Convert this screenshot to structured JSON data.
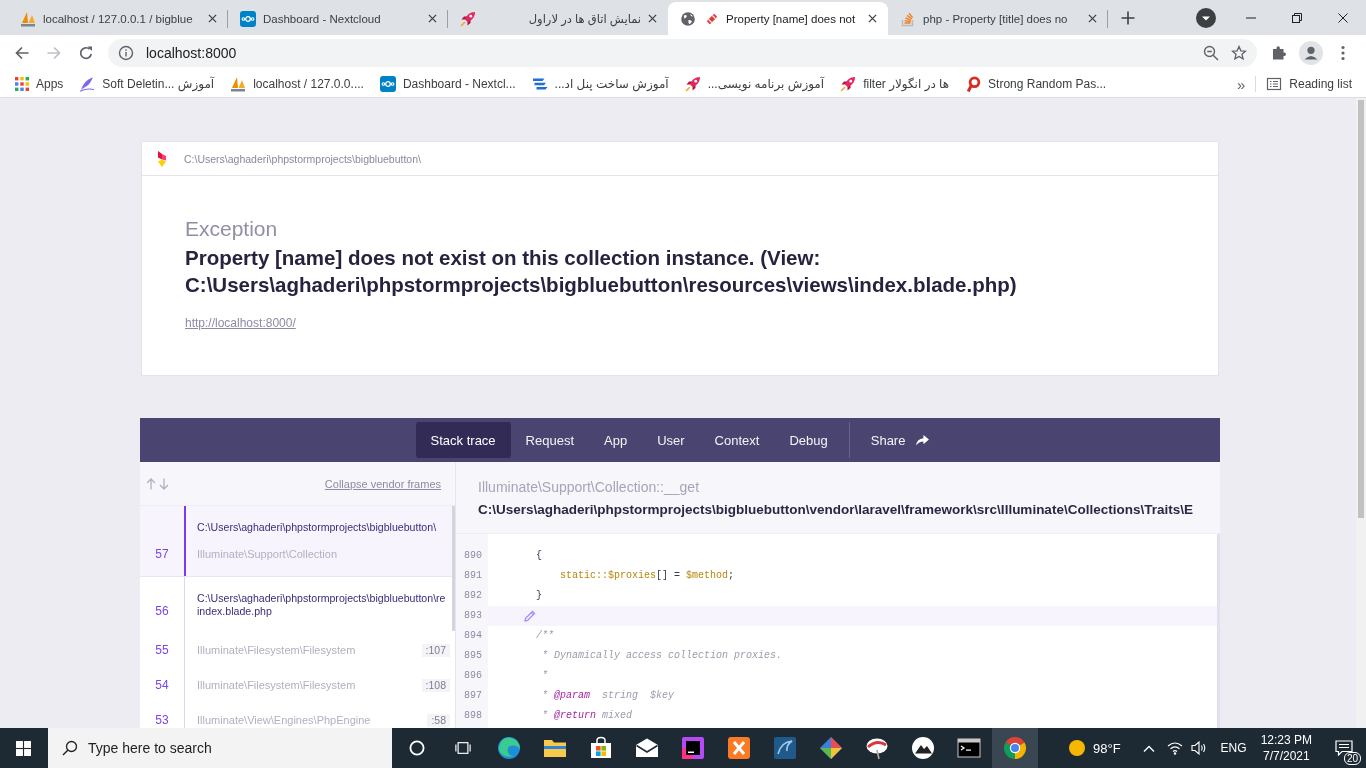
{
  "browser": {
    "tabs": [
      {
        "title": "localhost / 127.0.0.1 / bigblue",
        "selected": false
      },
      {
        "title": "Dashboard - Nextcloud",
        "selected": false
      },
      {
        "title": "نمایش اتاق ها در لاراول",
        "selected": false
      },
      {
        "title": "Property [name] does not",
        "selected": true
      },
      {
        "title": "php - Property [title] does no",
        "selected": false
      }
    ],
    "back_disabled": false,
    "forward_disabled": true,
    "address": "localhost:8000",
    "bookmarks": [
      "Apps",
      "Soft Deletin... آموزش",
      "localhost / 127.0.0....",
      "Dashboard - Nextcl...",
      "آموزش ساخت پنل اد...",
      "آموزش برنامه نویسی...",
      "filter ها در انگولار",
      "Strong Random Pas..."
    ],
    "bookmarks_overflow": "»",
    "reading_list": "Reading list"
  },
  "header": {
    "path": "C:\\Users\\aghaderi\\phpstormprojects\\bigbluebutton\\",
    "exception": "Exception",
    "message": "Property [name] does not exist on this collection instance. (View: C:\\Users\\aghaderi\\phpstormprojects\\bigbluebutton\\resources\\views\\index.blade.php)",
    "url": "http://localhost:8000/"
  },
  "nav": {
    "tabs": [
      {
        "label": "Stack trace",
        "selected": true
      },
      {
        "label": "Request",
        "selected": false
      },
      {
        "label": "App",
        "selected": false
      },
      {
        "label": "User",
        "selected": false
      },
      {
        "label": "Context",
        "selected": false
      },
      {
        "label": "Debug",
        "selected": false
      }
    ],
    "share": "Share"
  },
  "frames": {
    "collapse": "Collapse vendor frames",
    "items": [
      {
        "number": "57",
        "file": "C:\\Users\\aghaderi\\phpstormprojects\\bigbluebutton\\",
        "class": "Illuminate\\Support\\Collection",
        "selected": true
      },
      {
        "number": "56",
        "file": "C:\\Users\\aghaderi\\phpstormprojects\\bigbluebutton\\re",
        "file_name": "index.blade.php",
        "selected": false
      },
      {
        "number": "55",
        "class": "Illuminate\\Filesystem\\Filesystem",
        "line": ":107",
        "selected": false
      },
      {
        "number": "54",
        "class": "Illuminate\\Filesystem\\Filesystem",
        "line": ":108",
        "selected": false
      },
      {
        "number": "53",
        "class": "Illuminate\\View\\Engines\\PhpEngine",
        "line": ":58",
        "selected": false
      }
    ]
  },
  "code": {
    "signature": "Illuminate\\Support\\Collection::__get",
    "file": "C:\\Users\\aghaderi\\phpstormprojects\\bigbluebutton\\vendor\\laravel\\framework\\src\\Illuminate\\Collections\\Traits\\E",
    "lines": [
      {
        "number": "890",
        "highlighted": false,
        "tokens": [
          {
            "text": "    {",
            "kind": "plain"
          }
        ]
      },
      {
        "number": "891",
        "highlighted": false,
        "tokens": [
          {
            "text": "        static::$proxies",
            "kind": "variable"
          },
          {
            "text": "[] = ",
            "kind": "plain"
          },
          {
            "text": "$method",
            "kind": "variable"
          },
          {
            "text": ";",
            "kind": "plain"
          }
        ]
      },
      {
        "number": "892",
        "highlighted": false,
        "tokens": [
          {
            "text": "    }",
            "kind": "plain"
          }
        ]
      },
      {
        "number": "893",
        "highlighted": true
      },
      {
        "number": "894",
        "highlighted": false,
        "tokens": [
          {
            "text": "    /**",
            "kind": "comment"
          }
        ]
      },
      {
        "number": "895",
        "highlighted": false,
        "tokens": [
          {
            "text": "     * Dynamically access collection proxies.",
            "kind": "comment"
          }
        ]
      },
      {
        "number": "896",
        "highlighted": false,
        "tokens": [
          {
            "text": "     *",
            "kind": "comment"
          }
        ]
      },
      {
        "number": "897",
        "highlighted": false,
        "tokens": [
          {
            "text": "     * ",
            "kind": "comment"
          },
          {
            "text": "@param",
            "kind": "doctag"
          },
          {
            "text": "  string  $key",
            "kind": "comment"
          }
        ]
      },
      {
        "number": "898",
        "highlighted": false,
        "tokens": [
          {
            "text": "     * ",
            "kind": "comment"
          },
          {
            "text": "@return",
            "kind": "doctag"
          },
          {
            "text": " mixed",
            "kind": "comment"
          }
        ]
      }
    ]
  },
  "taskbar": {
    "search": {
      "placeholder": "Type here to search"
    },
    "apps": [
      {
        "selected": false
      },
      {
        "selected": false
      },
      {
        "selected": false
      },
      {
        "selected": false
      },
      {
        "selected": false
      },
      {
        "selected": false
      },
      {
        "selected": false
      },
      {
        "selected": false
      },
      {
        "selected": false
      },
      {
        "selected": false
      },
      {
        "selected": false
      },
      {
        "selected": true
      }
    ],
    "weather": "98°F",
    "language": "ENG",
    "time": "12:23 PM",
    "date": "7/7/2021",
    "notifications": "20"
  }
}
